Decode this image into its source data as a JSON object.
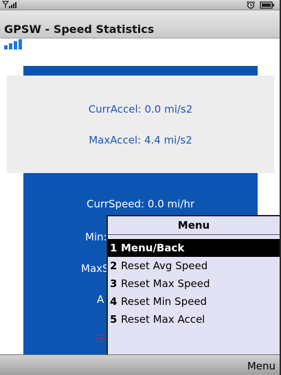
{
  "status_bar": {
    "signal_icon": "signal-strength-icon",
    "right_icons": [
      "alarm-clock-icon",
      "battery-icon"
    ]
  },
  "title_bar": {
    "title": "GPSW - Speed Statistics"
  },
  "app_signal_icon": "gps-signal-bars-icon",
  "stats": {
    "curr_accel": "CurrAccel: 0.0 mi/s2",
    "max_accel": "MaxAccel: 4.4 mi/s2",
    "curr_speed": "CurrSpeed: 0.0 mi/hr",
    "min_speed_partial": "Min:",
    "max_speed_partial": "MaxS",
    "avg_speed_partial": "A"
  },
  "menu": {
    "title": "Menu",
    "items": [
      {
        "num": "1",
        "label": "Menu/Back",
        "selected": true
      },
      {
        "num": "2",
        "label": "Reset Avg Speed",
        "selected": false
      },
      {
        "num": "3",
        "label": "Reset Max Speed",
        "selected": false
      },
      {
        "num": "4",
        "label": "Reset Min Speed",
        "selected": false
      },
      {
        "num": "5",
        "label": "Reset Max Accel",
        "selected": false
      }
    ]
  },
  "softkey": {
    "right_label": "Menu"
  },
  "colors": {
    "panel_blue": "#0d55b3",
    "accel_text": "#1f56b0",
    "menu_bg": "#e2e2f4"
  }
}
